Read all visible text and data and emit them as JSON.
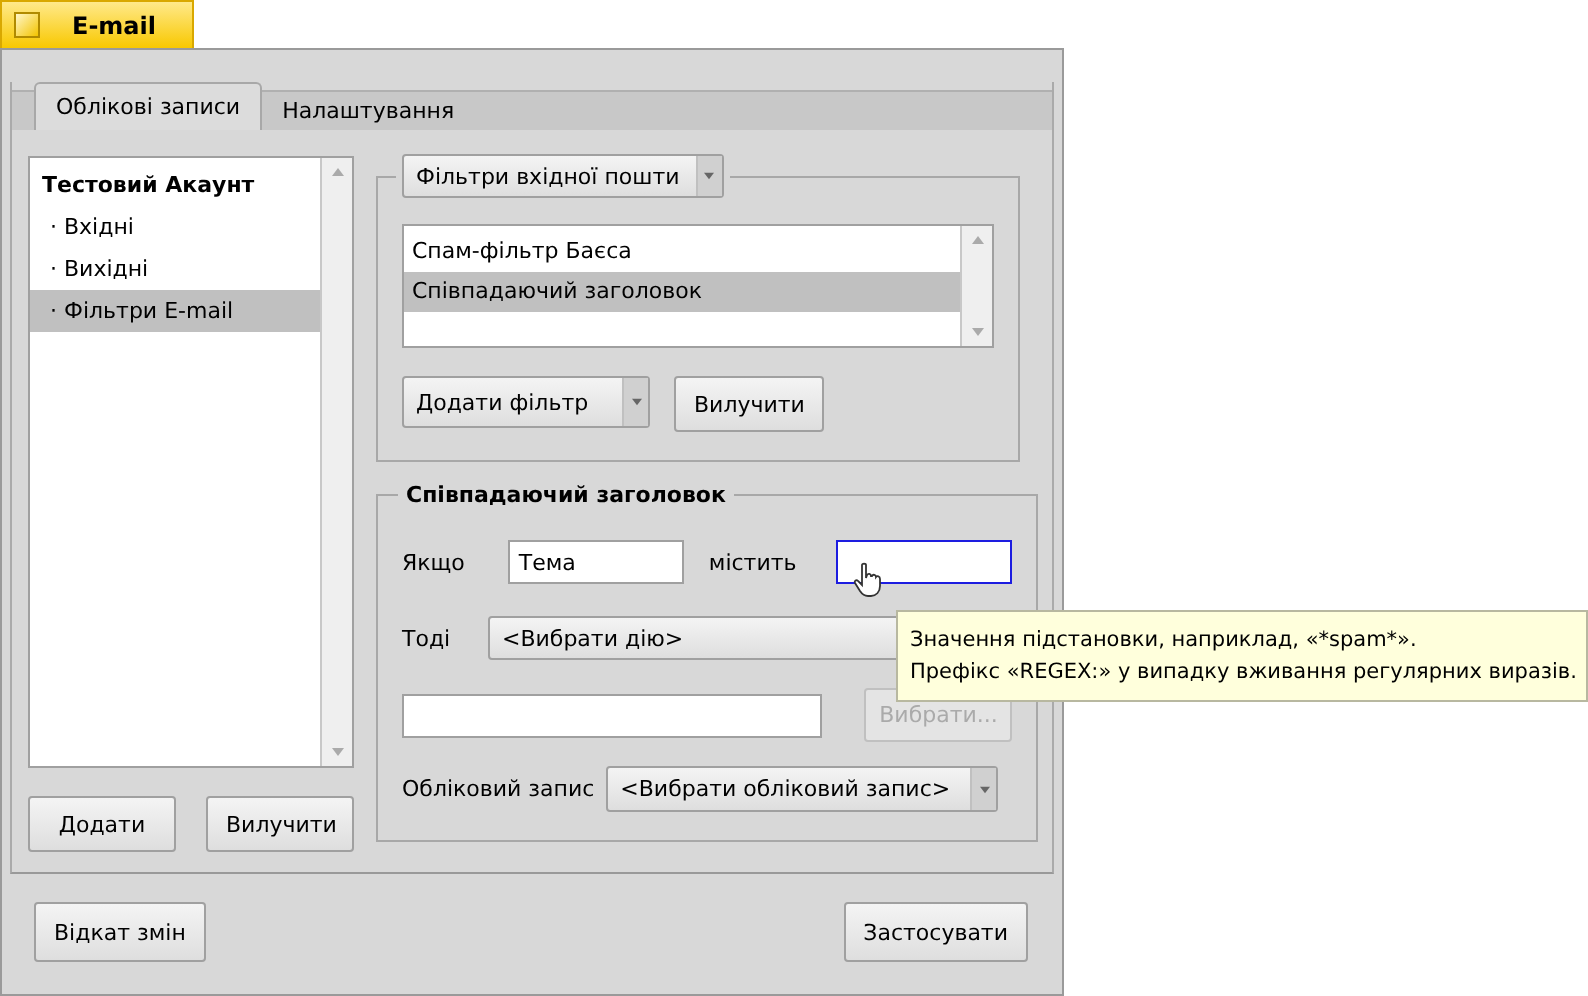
{
  "window": {
    "title": "E-mail"
  },
  "tabs": [
    {
      "label": "Облікові записи",
      "selected": true
    },
    {
      "label": "Налаштування",
      "selected": false
    }
  ],
  "accounts": [
    {
      "label": "Тестовий Акаунт",
      "selected": false,
      "children": [
        {
          "label": "· Вхідні",
          "selected": false
        },
        {
          "label": "· Вихідні",
          "selected": false
        },
        {
          "label": "· Фільтри E-mail",
          "selected": true
        }
      ]
    }
  ],
  "account_buttons": [
    "Додати",
    "Вилучити"
  ],
  "filters": {
    "mode_menu": "Фільтри вхідної пошти",
    "items": [
      {
        "label": "Спам-фільтр Баєса",
        "selected": false
      },
      {
        "label": "Співпадаючий заголовок",
        "selected": true
      }
    ],
    "add_menu": "Додати фільтр",
    "remove_button": "Вилучити"
  },
  "rule": {
    "title": "Співпадаючий заголовок",
    "if_label": "Якщо",
    "field_value": "Тема",
    "contains_label": "містить",
    "pattern_focused": true,
    "then_label": "Тоді",
    "action_menu": "<Вибрати дію>",
    "choose_button": {
      "label": "Вибрати...",
      "disabled": true
    },
    "account_label": "Обліковий запис",
    "account_menu": "<Вибрати обліковий запис>"
  },
  "tooltip": [
    "Значення підстановки, наприклад, «*spam*».",
    "Префікс «REGEX:» у випадку вживання регулярних виразів."
  ],
  "footer": {
    "revert_button": "Відкат змін",
    "apply_button": "Застосувати"
  }
}
